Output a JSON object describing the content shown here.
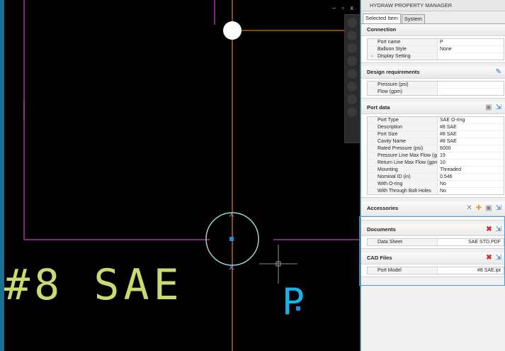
{
  "canvas": {
    "big_label": "#8 SAE",
    "port_label": "P",
    "view_controls": "– ▫ x"
  },
  "panel": {
    "title": "HYDRAW PROPERTY MANAGER",
    "tabs": [
      "Selected Item",
      "System"
    ],
    "connection": {
      "title": "Connection",
      "rows": [
        {
          "k": "Port name",
          "v": "P"
        },
        {
          "k": "Balloon Style",
          "v": "None"
        },
        {
          "k": "Display Setting",
          "v": ""
        }
      ]
    },
    "design": {
      "title": "Design requirements",
      "rows": [
        {
          "k": "Pressure (psi)",
          "v": ""
        },
        {
          "k": "Flow (gpm)",
          "v": ""
        }
      ]
    },
    "port_data": {
      "title": "Port data",
      "rows": [
        {
          "k": "Port Type",
          "v": "SAE O-ring"
        },
        {
          "k": "Description",
          "v": "#8 SAE"
        },
        {
          "k": "Port Size",
          "v": "#8 SAE"
        },
        {
          "k": "Cavity Name",
          "v": "#8 SAE"
        },
        {
          "k": "Rated Pressure (psi)",
          "v": "6000"
        },
        {
          "k": "Pressure Line Max Flow (gp",
          "v": "19"
        },
        {
          "k": "Return Line Max Flow (gpm)",
          "v": "10"
        },
        {
          "k": "Mounting",
          "v": "Threaded"
        },
        {
          "k": "Nominal ID (in)",
          "v": "0.546"
        },
        {
          "k": "With O-ring",
          "v": "No"
        },
        {
          "k": "With Through Bolt Holes",
          "v": "No"
        }
      ]
    },
    "accessories": {
      "title": "Accessories"
    },
    "documents": {
      "title": "Documents",
      "rows": [
        {
          "k": "Data Sheet",
          "v": "SAE STD.PDF"
        }
      ]
    },
    "cad_files": {
      "title": "CAD Files",
      "rows": [
        {
          "k": "Port Model",
          "v": "#8 SAE.ipt"
        }
      ]
    }
  }
}
